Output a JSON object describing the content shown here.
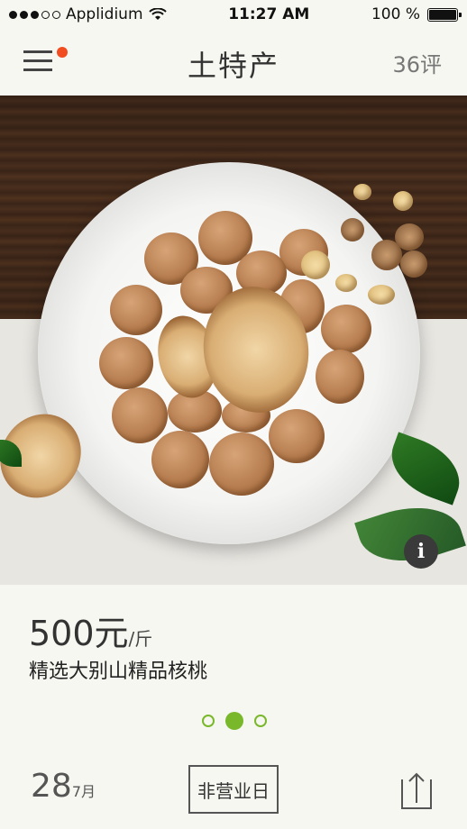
{
  "status": {
    "carrier": "Applidium",
    "time": "11:27 AM",
    "battery": "100 %"
  },
  "nav": {
    "title": "土特产",
    "reviews": "36评",
    "menu_icon": "hamburger-menu-icon",
    "has_notification": true
  },
  "product": {
    "price": "500元",
    "unit": "/斤",
    "name": "精选大别山精品核桃",
    "image": "walnuts-on-white-plate",
    "info_icon": "info-icon"
  },
  "pager": {
    "count": 3,
    "active_index": 1
  },
  "footer": {
    "day": "28",
    "month": "7月",
    "closed_label": "非营业日",
    "share_icon": "share-upload-icon"
  },
  "colors": {
    "accent_green": "#7ab82b",
    "badge_orange": "#f24c21",
    "background": "#f7f7f1"
  }
}
